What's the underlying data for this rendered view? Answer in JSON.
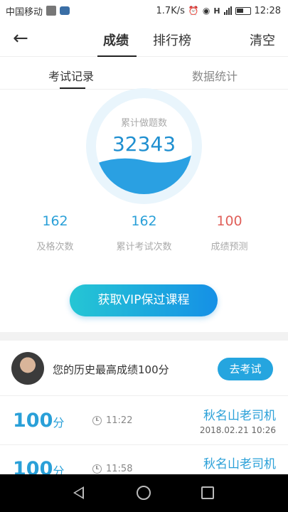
{
  "status_bar": {
    "carrier": "中国移动",
    "speed": "1.7K/s",
    "network": "H",
    "time": "12:28"
  },
  "header": {
    "back_icon": "arrow-left-icon",
    "tabs": [
      {
        "label": "成绩",
        "active": true
      },
      {
        "label": "排行榜",
        "active": false
      }
    ],
    "clear_label": "清空"
  },
  "sub_tabs": [
    {
      "label": "考试记录",
      "active": true
    },
    {
      "label": "数据统计",
      "active": false
    }
  ],
  "summary": {
    "total_label": "累计做题数",
    "total_value": "32343",
    "stats": [
      {
        "value": "162",
        "label": "及格次数",
        "color": "#2aa0d8"
      },
      {
        "value": "162",
        "label": "累计考试次数",
        "color": "#2aa0d8"
      },
      {
        "value": "100",
        "label": "成绩预测",
        "color": "#e0605a"
      }
    ]
  },
  "vip_button": "获取VIP保过课程",
  "best": {
    "text": "您的历史最高成绩100分",
    "button": "去考试"
  },
  "records": [
    {
      "score": "100",
      "unit": "分",
      "time": "11:22",
      "name": "秋名山老司机",
      "date": "2018.02.21  10:26"
    },
    {
      "score": "100",
      "unit": "分",
      "time": "11:58",
      "name": "秋名山老司机",
      "date": ""
    }
  ],
  "colors": {
    "accent": "#2aa0d8",
    "prediction": "#e0605a"
  }
}
